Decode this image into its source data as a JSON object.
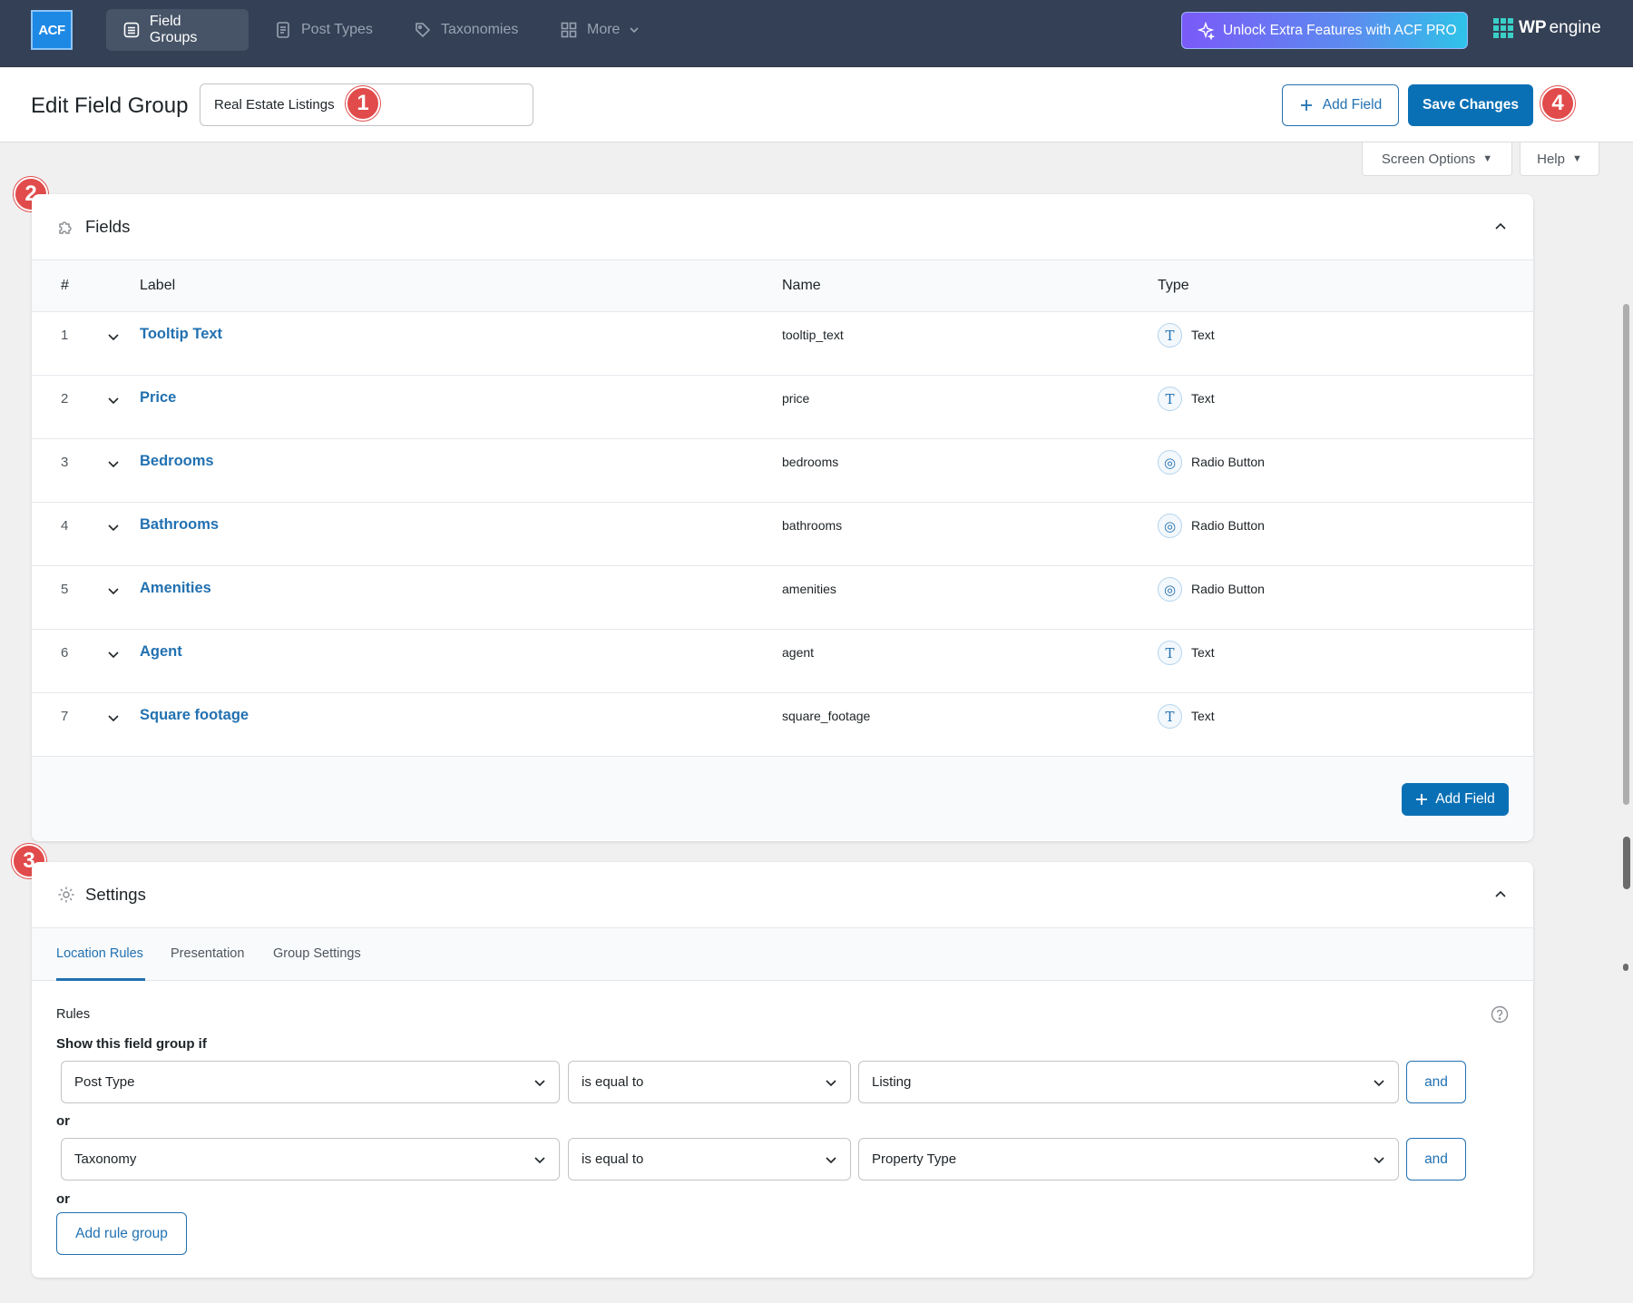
{
  "topnav": {
    "logo_text": "ACF",
    "tabs": [
      {
        "label": "Field Groups",
        "icon": "list-icon",
        "active": true
      },
      {
        "label": "Post Types",
        "icon": "document-icon",
        "active": false
      },
      {
        "label": "Taxonomies",
        "icon": "tag-icon",
        "active": false
      },
      {
        "label": "More",
        "icon": "grid-icon",
        "active": false
      }
    ],
    "promo_label": "Unlock Extra Features with ACF PRO",
    "brand_bold": "WP",
    "brand_light": "engine"
  },
  "header": {
    "page_title": "Edit Field Group",
    "title_value": "Real Estate Listings",
    "add_field_label": "Add Field",
    "save_label": "Save Changes"
  },
  "screen_options_label": "Screen Options",
  "help_label": "Help",
  "badges": [
    "1",
    "2",
    "3",
    "4"
  ],
  "fields_panel": {
    "title": "Fields",
    "columns": [
      "#",
      "Label",
      "Name",
      "Type"
    ],
    "rows": [
      {
        "num": "1",
        "label": "Tooltip Text",
        "name": "tooltip_text",
        "type": "Text",
        "icon": "T"
      },
      {
        "num": "2",
        "label": "Price",
        "name": "price",
        "type": "Text",
        "icon": "T"
      },
      {
        "num": "3",
        "label": "Bedrooms",
        "name": "bedrooms",
        "type": "Radio Button",
        "icon": "◎"
      },
      {
        "num": "4",
        "label": "Bathrooms",
        "name": "bathrooms",
        "type": "Radio Button",
        "icon": "◎"
      },
      {
        "num": "5",
        "label": "Amenities",
        "name": "amenities",
        "type": "Radio Button",
        "icon": "◎"
      },
      {
        "num": "6",
        "label": "Agent",
        "name": "agent",
        "type": "Text",
        "icon": "T"
      },
      {
        "num": "7",
        "label": "Square footage",
        "name": "square_footage",
        "type": "Text",
        "icon": "T"
      }
    ],
    "add_field_label": "Add Field"
  },
  "settings_panel": {
    "title": "Settings",
    "tabs": [
      "Location Rules",
      "Presentation",
      "Group Settings"
    ],
    "rules_label": "Rules",
    "show_if_label": "Show this field group if",
    "or_label": "or",
    "rule_groups": [
      {
        "param": "Post Type",
        "operator": "is equal to",
        "value": "Listing",
        "and_label": "and"
      },
      {
        "param": "Taxonomy",
        "operator": "is equal to",
        "value": "Property Type",
        "and_label": "and"
      }
    ],
    "add_rule_group_label": "Add rule group"
  },
  "colors": {
    "nav_bg": "#344055",
    "primary": "#2271b1",
    "badge": "#e14b4b"
  }
}
